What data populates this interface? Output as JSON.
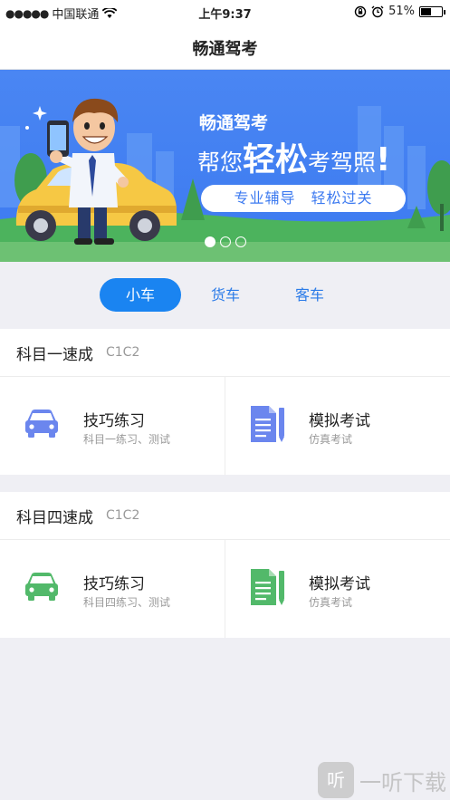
{
  "status_bar": {
    "signal_dots": "●●●●●",
    "carrier": "中国联通",
    "wifi_icon": "wifi-icon",
    "time": "上午9:37",
    "battery_percent": "51%",
    "battery_level": 0.51
  },
  "nav": {
    "title": "畅通驾考"
  },
  "banner": {
    "brand": "畅通驾考",
    "line_pre": "帮您",
    "line_big": "轻松",
    "line_post": "考驾照",
    "line_bang": "!",
    "pill": "专业辅导　轻松过关",
    "page_count": 3,
    "active_page": 1
  },
  "tabs": [
    {
      "label": "小车",
      "active": true
    },
    {
      "label": "货车",
      "active": false
    },
    {
      "label": "客车",
      "active": false
    }
  ],
  "sections": [
    {
      "title": "科目一速成",
      "sub": "C1C2",
      "accent": "#6b86ee",
      "practice": {
        "title": "技巧练习",
        "sub": "科目一练习、测试",
        "icon": "car-icon"
      },
      "exam": {
        "title": "模拟考试",
        "sub": "仿真考试",
        "icon": "exam-document-icon"
      }
    },
    {
      "title": "科目四速成",
      "sub": "C1C2",
      "accent": "#52b96a",
      "practice": {
        "title": "技巧练习",
        "sub": "科目四练习、测试",
        "icon": "car-icon"
      },
      "exam": {
        "title": "模拟考试",
        "sub": "仿真考试",
        "icon": "exam-document-icon"
      }
    }
  ],
  "watermark": {
    "glyph": "听",
    "text": "一听下载"
  },
  "colors": {
    "primary": "#1a84f1",
    "banner_bg": "#3c7af0",
    "page_bg": "#efeff4"
  }
}
